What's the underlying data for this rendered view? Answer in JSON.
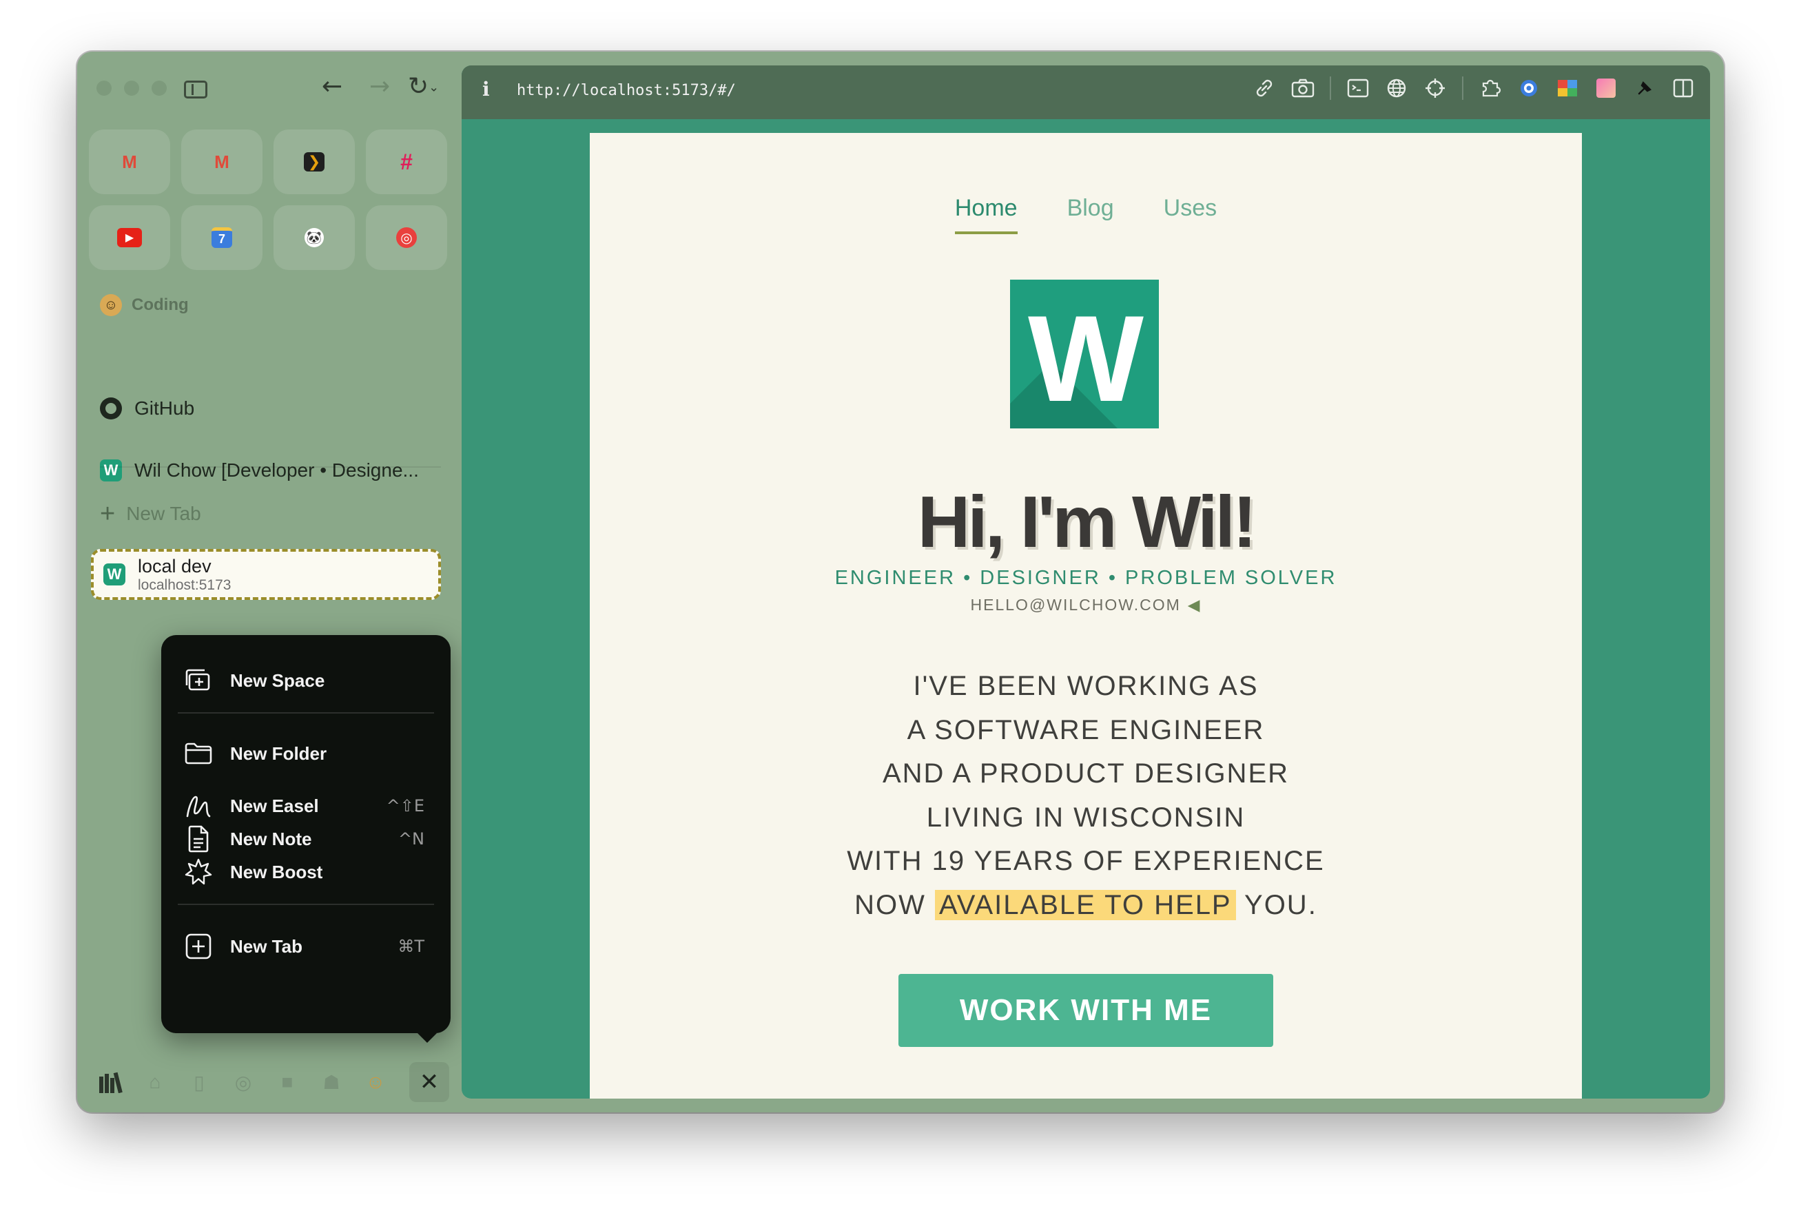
{
  "sidebar": {
    "favorites": [
      {
        "name": "gmail",
        "icon": "gmail-icon",
        "glyph": "M",
        "color": "#e04a3a"
      },
      {
        "name": "gmail-2",
        "icon": "gmail-icon",
        "glyph": "M",
        "color": "#e04a3a"
      },
      {
        "name": "plex",
        "icon": "plex-icon",
        "glyph": "❯",
        "color": "#1f1f1f"
      },
      {
        "name": "slack",
        "icon": "slack-icon",
        "glyph": "#",
        "color": "#4a154b"
      },
      {
        "name": "youtube",
        "icon": "youtube-icon",
        "glyph": "▶",
        "color": "#e62117"
      },
      {
        "name": "calendar",
        "icon": "calendar-icon",
        "glyph": "7",
        "color": "#3b7ddd"
      },
      {
        "name": "panda",
        "icon": "panda-icon",
        "glyph": "🐼",
        "color": "#ffffff"
      },
      {
        "name": "pocketcasts",
        "icon": "pocketcasts-icon",
        "glyph": "◎",
        "color": "#e9403d"
      }
    ],
    "section_label": "Coding",
    "links": [
      {
        "label": "GitHub",
        "icon": "github-icon"
      },
      {
        "label": "Wil Chow [Developer • Designe...",
        "icon": "w-icon"
      }
    ],
    "new_tab_label": "New Tab",
    "active_tab": {
      "title": "local dev",
      "url": "localhost:5173"
    }
  },
  "menu": {
    "items": [
      {
        "label": "New Space",
        "shortcut": "",
        "icon": "new-space-icon"
      },
      {
        "label": "New Folder",
        "shortcut": "",
        "icon": "folder-icon"
      },
      {
        "label": "New Easel",
        "shortcut": "^⇧E",
        "icon": "easel-icon"
      },
      {
        "label": "New Note",
        "shortcut": "^N",
        "icon": "note-icon"
      },
      {
        "label": "New Boost",
        "shortcut": "",
        "icon": "boost-icon"
      },
      {
        "label": "New Tab",
        "shortcut": "⌘T",
        "icon": "new-tab-icon"
      }
    ]
  },
  "browser": {
    "url": "http://localhost:5173/#/",
    "info_glyph": "i"
  },
  "page": {
    "nav": [
      "Home",
      "Blog",
      "Uses"
    ],
    "logo_letter": "W",
    "title": "Hi, I'm Wil!",
    "subtitle": "ENGINEER • DESIGNER • PROBLEM SOLVER",
    "email": "HELLO@WILCHOW.COM",
    "bio_lines": [
      "I'VE BEEN WORKING AS",
      "A SOFTWARE ENGINEER",
      "AND A PRODUCT DESIGNER",
      "LIVING IN WISCONSIN",
      "WITH 19 YEARS OF EXPERIENCE"
    ],
    "bio_last": {
      "before": "NOW ",
      "highlight": "AVAILABLE TO HELP",
      "after": " YOU."
    },
    "cta": "WORK WITH ME"
  },
  "colors": {
    "sidebar_bg": "#8aa889",
    "content_bg": "#3a9577",
    "page_bg": "#f8f6ec",
    "accent": "#1f9e7e",
    "highlight": "#fbd97a"
  }
}
